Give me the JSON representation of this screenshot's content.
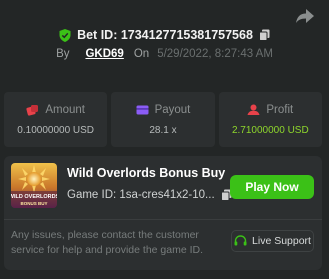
{
  "header": {
    "bet_label": "Bet ID: 1734127715381757568",
    "by_label": "By",
    "username": "GKD69",
    "on_label": "On",
    "datetime": "5/29/2022, 8:27:43 AM"
  },
  "stats": [
    {
      "label": "Amount",
      "value": "0.10000000 USD",
      "icon": "dice-icon"
    },
    {
      "label": "Payout",
      "value": "28.1 x",
      "icon": "card-icon"
    },
    {
      "label": "Profit",
      "value": "2.71000000 USD",
      "icon": "profit-icon"
    }
  ],
  "game": {
    "thumb_text": "WILD OVERLORDS BONUS BUY",
    "title": "Wild Overlords Bonus Buy",
    "id_label": "Game ID: 1sa-cres41x2-10...",
    "play_label": "Play Now",
    "help_text": "Any issues, please contact the customer service for help and provide the game ID.",
    "support_label": "Live Support"
  },
  "colors": {
    "background": "#232626",
    "card": "#2c2f30",
    "accent_green": "#3bc117",
    "profit_green": "#8ed62c",
    "red_icon": "#e8424a",
    "purple_icon": "#8b5cf6"
  }
}
